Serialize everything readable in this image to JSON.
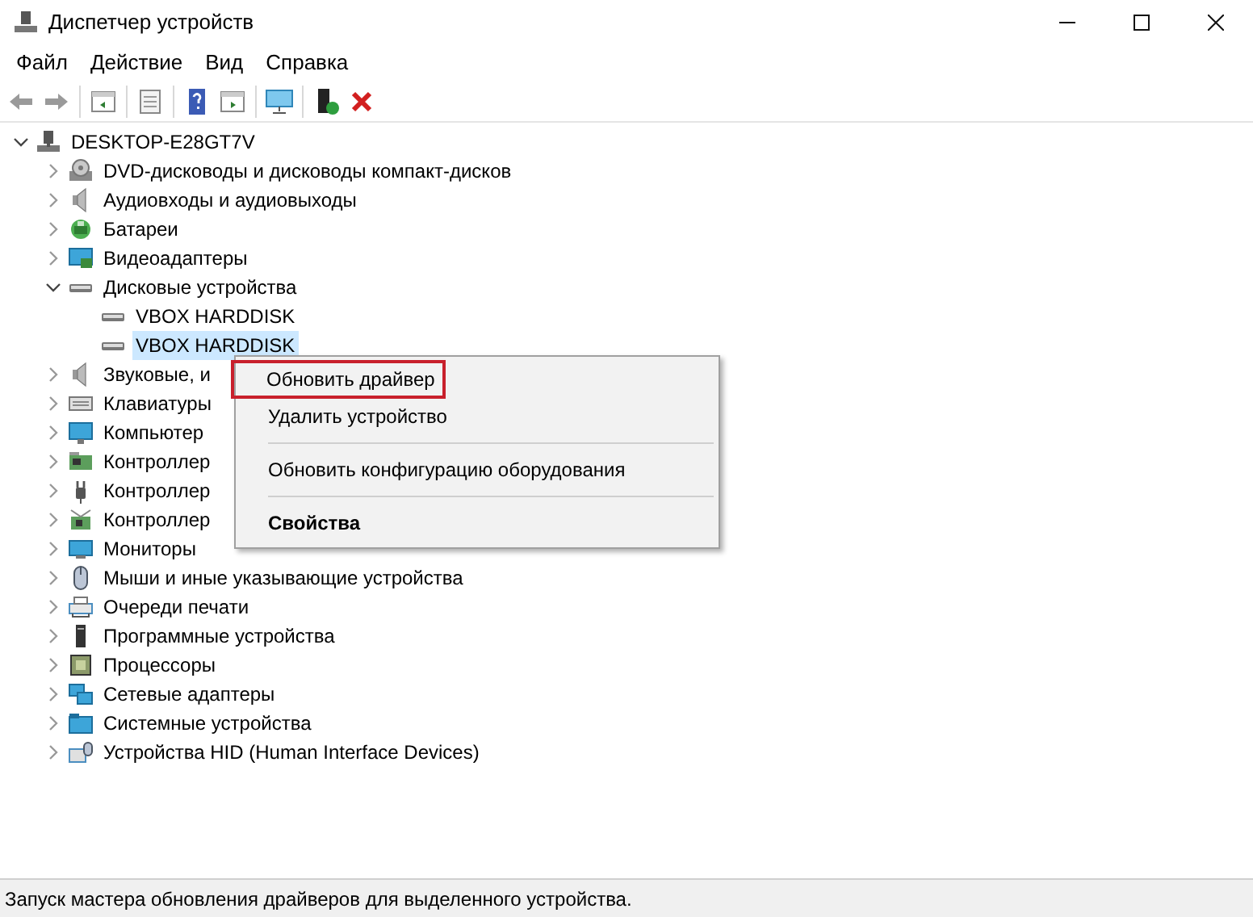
{
  "window": {
    "title": "Диспетчер устройств"
  },
  "menu_bar": [
    "Файл",
    "Действие",
    "Вид",
    "Справка"
  ],
  "tree": {
    "label": "DESKTOP-E28GT7V",
    "expanded": true,
    "selected": false,
    "children": [
      {
        "label": "DVD-дисководы и дисководы компакт-дисков",
        "expanded": false,
        "selected": false
      },
      {
        "label": "Аудиовходы и аудиовыходы",
        "expanded": false,
        "selected": false
      },
      {
        "label": "Батареи",
        "expanded": false,
        "selected": false
      },
      {
        "label": "Видеоадаптеры",
        "expanded": false,
        "selected": false
      },
      {
        "label": "Дисковые устройства",
        "expanded": true,
        "selected": false,
        "children": [
          {
            "label": "VBOX HARDDISK",
            "selected": false
          },
          {
            "label": "VBOX HARDDISK",
            "selected": true
          }
        ]
      },
      {
        "label": "Звуковые, и",
        "expanded": false,
        "selected": false
      },
      {
        "label": "Клавиатуры",
        "expanded": false,
        "selected": false
      },
      {
        "label": "Компьютер",
        "expanded": false,
        "selected": false
      },
      {
        "label": "Контроллер",
        "expanded": false,
        "selected": false
      },
      {
        "label": "Контроллер",
        "expanded": false,
        "selected": false
      },
      {
        "label": "Контроллер",
        "expanded": false,
        "selected": false
      },
      {
        "label": "Мониторы",
        "expanded": false,
        "selected": false
      },
      {
        "label": "Мыши и иные указывающие устройства",
        "expanded": false,
        "selected": false
      },
      {
        "label": "Очереди печати",
        "expanded": false,
        "selected": false
      },
      {
        "label": "Программные устройства",
        "expanded": false,
        "selected": false
      },
      {
        "label": "Процессоры",
        "expanded": false,
        "selected": false
      },
      {
        "label": "Сетевые адаптеры",
        "expanded": false,
        "selected": false
      },
      {
        "label": "Системные устройства",
        "expanded": false,
        "selected": false
      },
      {
        "label": "Устройства HID (Human Interface Devices)",
        "expanded": false,
        "selected": false
      }
    ]
  },
  "context_menu": [
    {
      "kind": "item",
      "label": "Обновить драйвер",
      "highlighted": true,
      "bold": false
    },
    {
      "kind": "item",
      "label": "Удалить устройство",
      "highlighted": false,
      "bold": false
    },
    {
      "kind": "separator"
    },
    {
      "kind": "item",
      "label": "Обновить конфигурацию оборудования",
      "highlighted": false,
      "bold": false
    },
    {
      "kind": "separator"
    },
    {
      "kind": "item",
      "label": "Свойства",
      "highlighted": false,
      "bold": true
    }
  ],
  "status_bar": "Запуск мастера обновления драйверов для выделенного устройства."
}
